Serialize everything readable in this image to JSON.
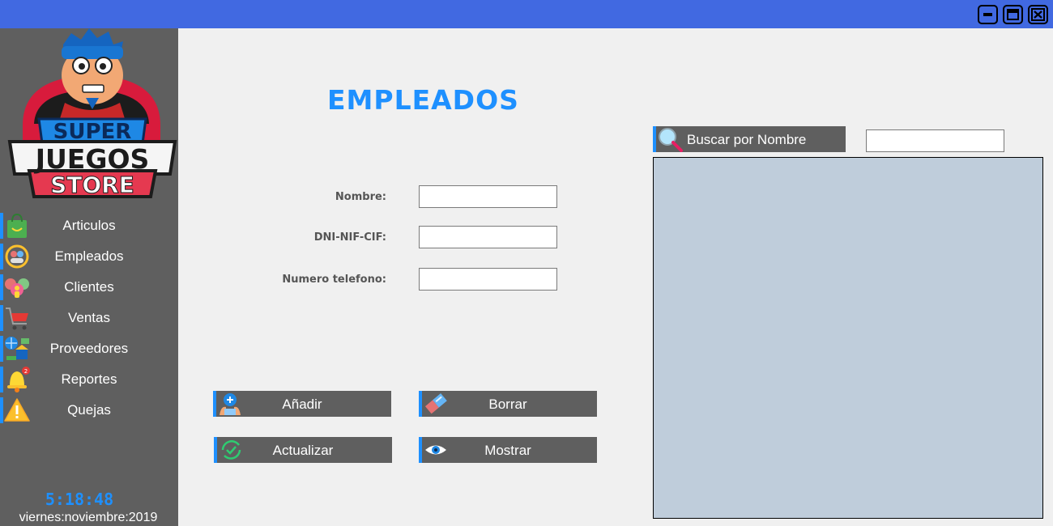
{
  "colors": {
    "titlebar": "#4169e1",
    "sidebar": "#5f5f5f",
    "accent": "#1e90ff",
    "background": "#f0f0f0",
    "table_background": "#bfcddb"
  },
  "window_controls": {
    "minimize_icon": "minimize-icon",
    "maximize_icon": "maximize-icon",
    "close_icon": "close-icon"
  },
  "logo": {
    "line1": "SUPER",
    "line2": "JUEGOS",
    "line3": "STORE"
  },
  "sidebar": {
    "items": [
      {
        "label": "Articulos",
        "icon": "shopping-bag-icon"
      },
      {
        "label": "Empleados",
        "icon": "employees-icon"
      },
      {
        "label": "Clientes",
        "icon": "clients-icon"
      },
      {
        "label": "Ventas",
        "icon": "cart-icon"
      },
      {
        "label": "Proveedores",
        "icon": "suppliers-icon"
      },
      {
        "label": "Reportes",
        "icon": "bell-icon"
      },
      {
        "label": "Quejas",
        "icon": "warning-icon"
      }
    ],
    "clock": "5:18:48",
    "date": "viernes:noviembre:2019"
  },
  "main": {
    "title": "EMPLEADOS",
    "form": {
      "nombre_label": "Nombre:",
      "nombre_value": "",
      "dni_label": "DNI-NIF-CIF:",
      "dni_value": "",
      "telefono_label": "Numero telefono:",
      "telefono_value": ""
    },
    "buttons": {
      "add": "Añadir",
      "delete": "Borrar",
      "update": "Actualizar",
      "show": "Mostrar"
    },
    "search": {
      "button_label": "Buscar por Nombre",
      "value": ""
    }
  }
}
